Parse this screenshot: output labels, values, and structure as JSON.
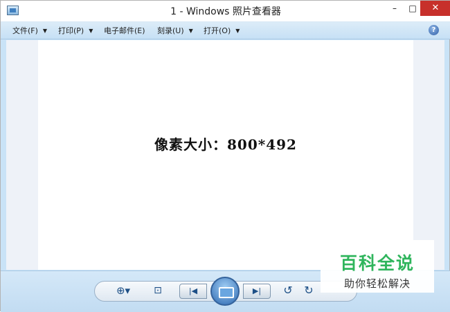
{
  "window": {
    "title": "1 - Windows 照片查看器",
    "minimize_label": "–",
    "maximize_label": "□",
    "close_label": "✕"
  },
  "menu": {
    "items": [
      {
        "label": "文件(F)",
        "icon": "chevron-down-icon"
      },
      {
        "label": "打印(P)",
        "icon": "chevron-down-icon"
      },
      {
        "label": "电子邮件(E)",
        "icon": null
      },
      {
        "label": "刻录(U)",
        "icon": "chevron-down-icon"
      },
      {
        "label": "打开(O)",
        "icon": "chevron-down-icon"
      }
    ],
    "help_label": "?"
  },
  "photo": {
    "text": "像素大小：800*492"
  },
  "controls": {
    "zoom_label": "⊕▾",
    "fit_label": "⊡",
    "prev_label": "|◀",
    "next_label": "▶|",
    "rotate_ccw_label": "↺",
    "rotate_cw_label": "↻"
  },
  "watermark": {
    "main": "百科全说",
    "sub": "助你轻松解决",
    "color": "#2fb55c"
  }
}
